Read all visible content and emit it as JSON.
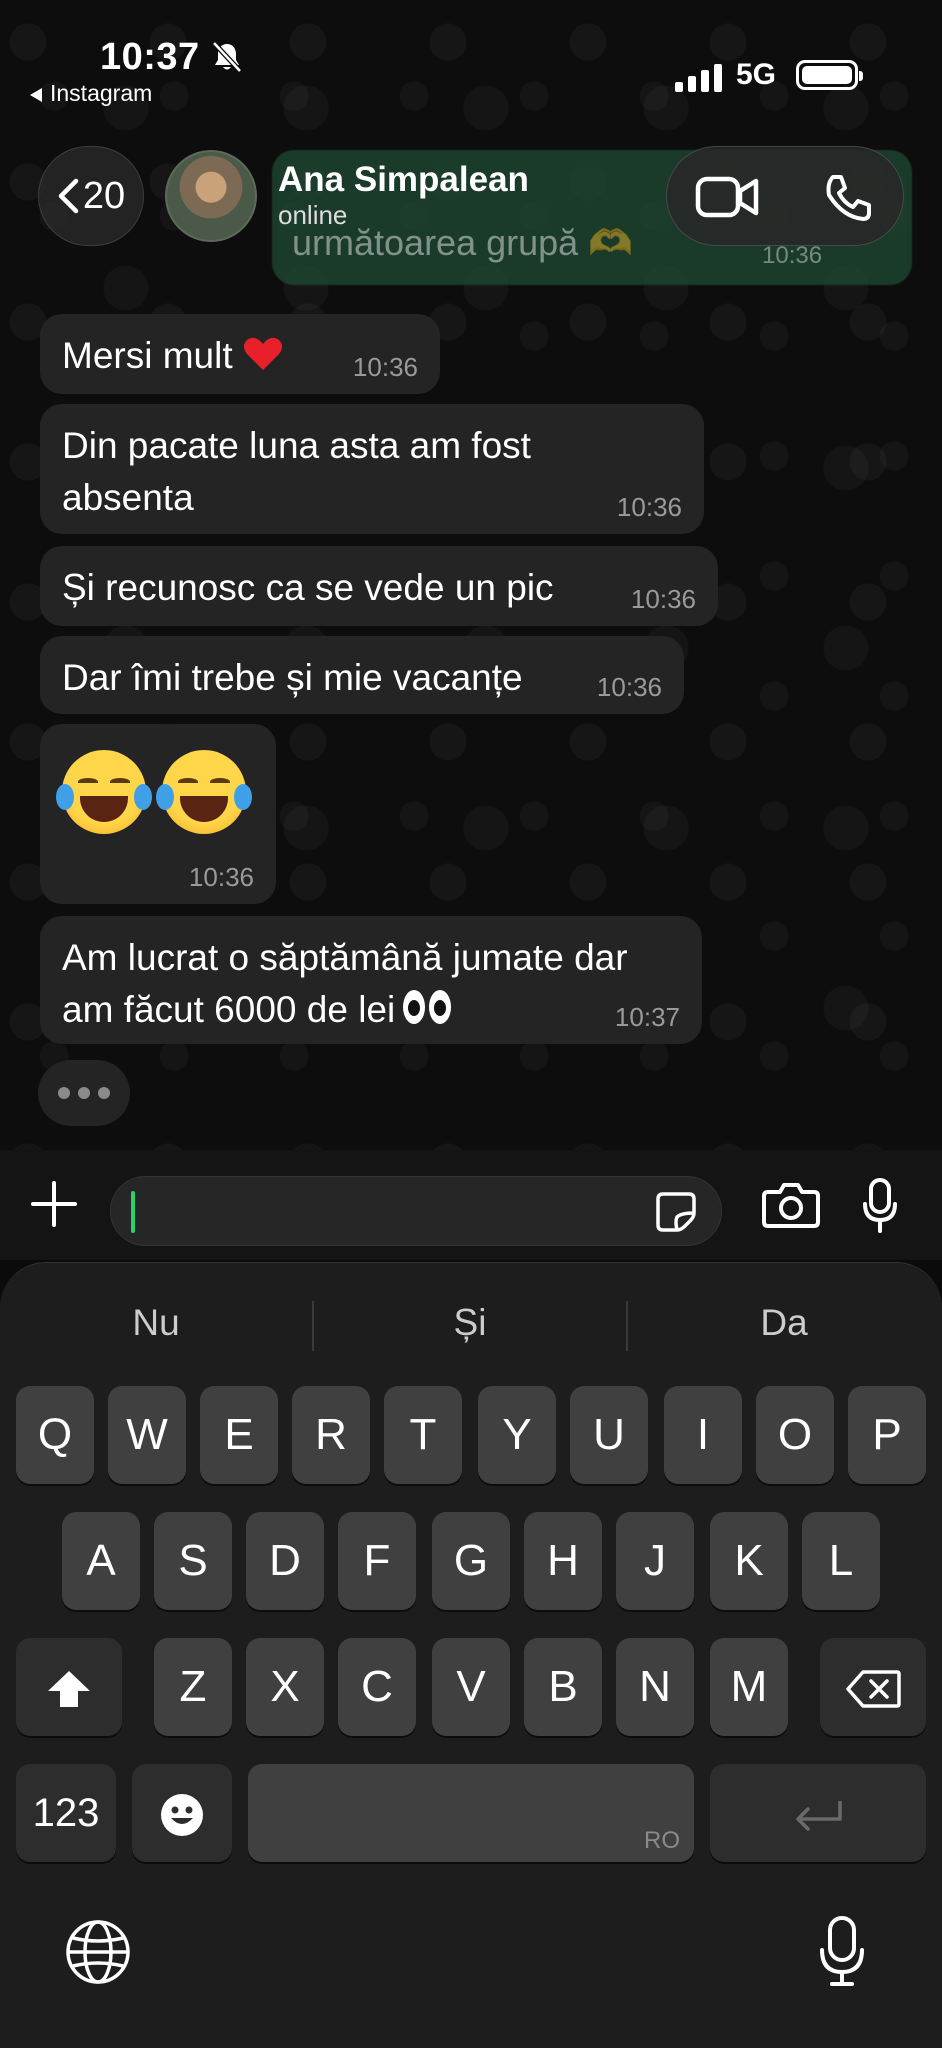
{
  "status_bar": {
    "time": "10:37",
    "back_app": "Instagram",
    "network": "5G"
  },
  "preview": {
    "text": "următoarea grupă 🫶",
    "time": "10:36"
  },
  "header": {
    "back_count": "20",
    "contact_name": "Ana Simpalean",
    "contact_status": "online"
  },
  "messages": [
    {
      "text": "Mersi mult",
      "time": "10:36"
    },
    {
      "line1": "Din pacate luna asta am fost",
      "line2": "absenta",
      "time": "10:36"
    },
    {
      "text": "Și recunosc ca se vede un pic",
      "time": "10:36"
    },
    {
      "text": "Dar îmi trebe și mie vacanțe",
      "time": "10:36"
    },
    {
      "text": "",
      "time": "10:36"
    },
    {
      "line1": "Am lucrat o săptămână jumate dar",
      "line2": "am făcut 6000 de lei",
      "time": "10:37"
    }
  ],
  "input": {
    "value": "",
    "placeholder": ""
  },
  "keyboard": {
    "suggestions": [
      "Nu",
      "Și",
      "Da"
    ],
    "row1": [
      "Q",
      "W",
      "E",
      "R",
      "T",
      "Y",
      "U",
      "I",
      "O",
      "P"
    ],
    "row2": [
      "A",
      "S",
      "D",
      "F",
      "G",
      "H",
      "J",
      "K",
      "L"
    ],
    "row3": [
      "Z",
      "X",
      "C",
      "V",
      "B",
      "N",
      "M"
    ],
    "numbers_key": "123",
    "space_lang": "RO"
  },
  "icons": [
    "bell-slash-icon",
    "signal-icon",
    "battery-icon",
    "chevron-left-icon",
    "video-call-icon",
    "phone-call-icon",
    "heart-emoji",
    "tears-of-joy-emoji",
    "eyes-emoji",
    "plus-icon",
    "sticker-icon",
    "camera-icon",
    "mic-icon",
    "shift-icon",
    "backspace-icon",
    "emoji-icon",
    "return-icon",
    "globe-icon"
  ],
  "colors": {
    "accent": "#25d366",
    "bubble": "#242424",
    "background": "#0d0d0d"
  }
}
